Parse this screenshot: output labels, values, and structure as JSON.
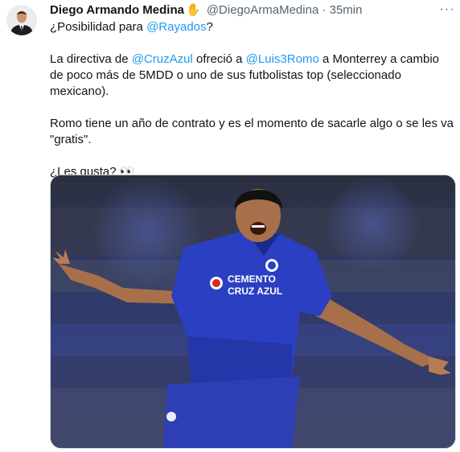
{
  "author": {
    "name": "Diego Armando Medina",
    "emoji": "✋",
    "handle": "@DiegoArmaMedina",
    "separator": "·",
    "time": "35min"
  },
  "more_label": "···",
  "tweet": {
    "line1_prefix": "¿Posibilidad para ",
    "line1_mention": "@Rayados",
    "line1_suffix": "?",
    "p2_a": "La directiva de ",
    "p2_mention1": "@CruzAzul",
    "p2_b": " ofreció a ",
    "p2_mention2": "@Luis3Romo",
    "p2_c": " a Monterrey a cambio de poco más de 5MDD o uno de sus futbolistas top (seleccionado mexicano).",
    "p3": "Romo tiene un año de contrato y es el momento de sacarle algo o se les va \"gratis\".",
    "p4": "¿Les gusta? 👀"
  },
  "media": {
    "jersey_text_1": "CEMENTO",
    "jersey_text_2": "CRUZ AZUL",
    "colors": {
      "jersey": "#2b3fc2",
      "sky": "#2a3350",
      "pitch": "#3b3f63",
      "skin": "#a8704a"
    }
  }
}
